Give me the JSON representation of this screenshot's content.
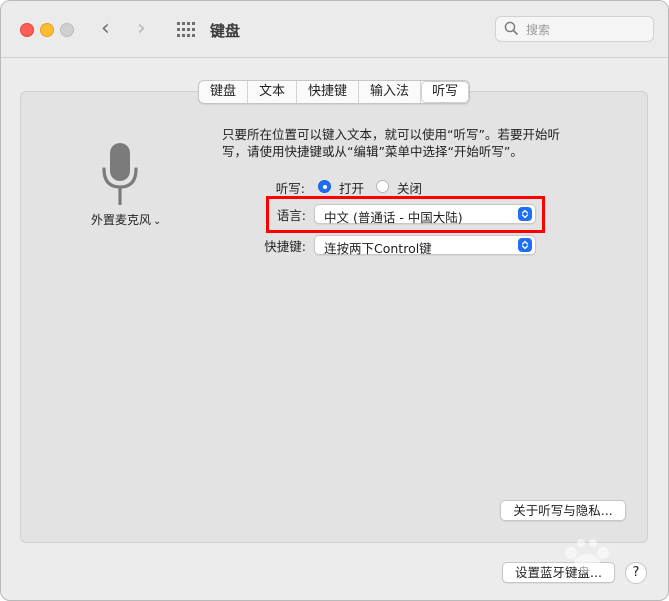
{
  "window": {
    "title": "键盘",
    "search_placeholder": "搜索"
  },
  "tabs": [
    {
      "label": "键盘",
      "active": false
    },
    {
      "label": "文本",
      "active": false
    },
    {
      "label": "快捷键",
      "active": false
    },
    {
      "label": "输入法",
      "active": false
    },
    {
      "label": "听写",
      "active": true
    }
  ],
  "microphone": {
    "label": "外置麦克风",
    "chevron": "⌄"
  },
  "description": {
    "line1": "只要所在位置可以键入文本，就可以使用“听写”。若要开始听",
    "line2": "写，请使用快捷键或从“编辑”菜单中选择“开始听写”。"
  },
  "dictation": {
    "label": "听写:",
    "on_label": "打开",
    "off_label": "关闭",
    "selected": "on"
  },
  "language": {
    "label": "语言:",
    "value": "中文 (普通话 - 中国大陆)"
  },
  "shortcut": {
    "label": "快捷键:",
    "value": "连按两下Control键"
  },
  "buttons": {
    "privacy": "关于听写与隐私...",
    "bluetooth": "设置蓝牙键盘...",
    "help": "?"
  },
  "colors": {
    "accent": "#1e6ff5",
    "highlight": "#ff0000"
  }
}
